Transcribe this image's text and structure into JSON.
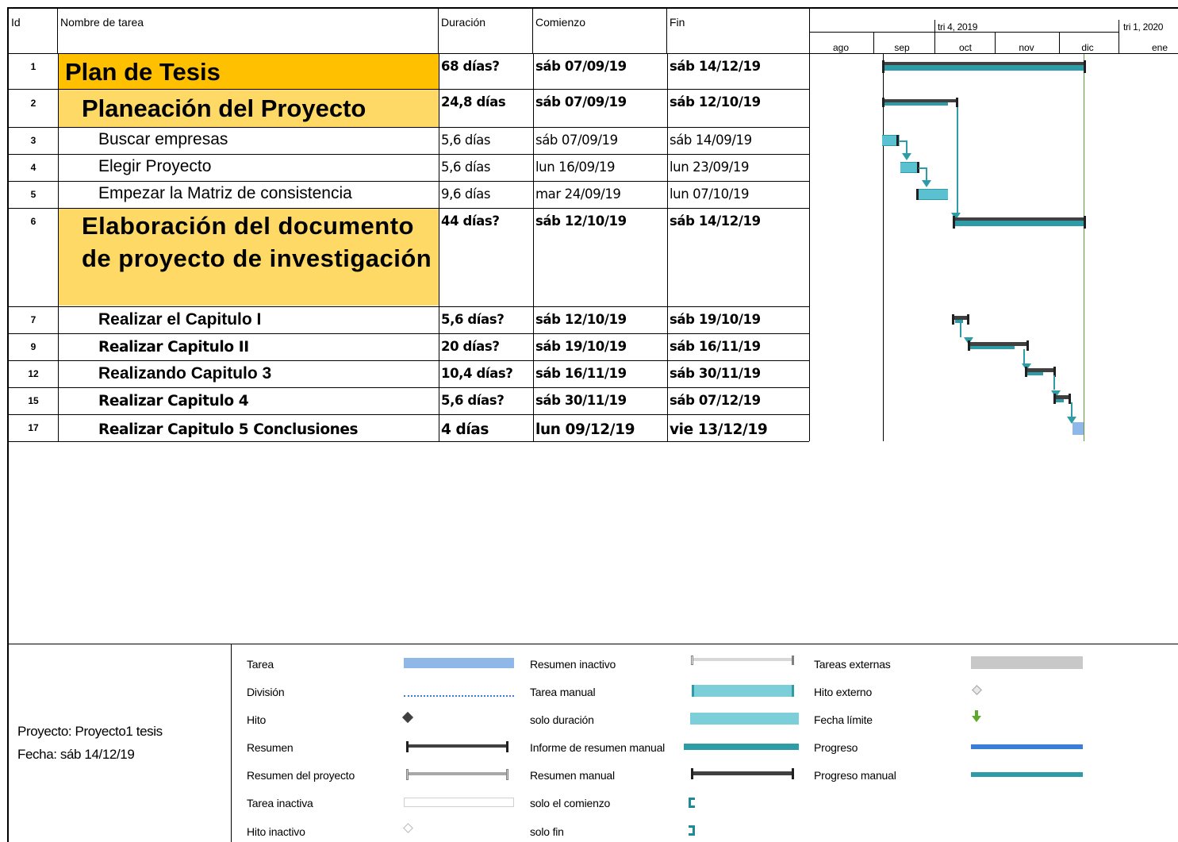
{
  "header": {
    "id": "Id",
    "name": "Nombre de tarea",
    "duration": "Duración",
    "start": "Comienzo",
    "finish": "Fin"
  },
  "timescale": {
    "quarters": [
      "tri 4, 2019",
      "tri 1, 2020"
    ],
    "months": [
      "ago",
      "sep",
      "oct",
      "nov",
      "dic",
      "ene"
    ]
  },
  "tasks": [
    {
      "id": "1",
      "name": "Plan de Tesis",
      "duration": "68 días?",
      "start": "sáb 07/09/19",
      "finish": "sáb 14/12/19"
    },
    {
      "id": "2",
      "name": "Planeación del Proyecto",
      "duration": "24,8 días",
      "start": "sáb 07/09/19",
      "finish": "sáb 12/10/19"
    },
    {
      "id": "3",
      "name": "Buscar empresas",
      "duration": "5,6 días",
      "start": "sáb 07/09/19",
      "finish": "sáb 14/09/19"
    },
    {
      "id": "4",
      "name": "Elegir Proyecto",
      "duration": "5,6 días",
      "start": "lun 16/09/19",
      "finish": "lun 23/09/19"
    },
    {
      "id": "5",
      "name": "Empezar la Matriz de consistencia",
      "duration": "9,6 días",
      "start": "mar 24/09/19",
      "finish": "lun 07/10/19"
    },
    {
      "id": "6",
      "name_line1": "Elaboración del documento",
      "name_line2": "de proyecto de investigación",
      "duration": "44 días?",
      "start": "sáb 12/10/19",
      "finish": "sáb 14/12/19"
    },
    {
      "id": "7",
      "name": "Realizar el Capitulo I",
      "duration": "5,6 días?",
      "start": "sáb 12/10/19",
      "finish": "sáb 19/10/19"
    },
    {
      "id": "9",
      "name": "Realizar Capitulo II",
      "duration": "20 días?",
      "start": "sáb 19/10/19",
      "finish": "sáb 16/11/19"
    },
    {
      "id": "12",
      "name": "Realizando Capitulo 3",
      "duration": "10,4 días?",
      "start": "sáb 16/11/19",
      "finish": "sáb 30/11/19"
    },
    {
      "id": "15",
      "name": "Realizar Capitulo 4",
      "duration": "5,6 días?",
      "start": "sáb 30/11/19",
      "finish": "sáb 07/12/19"
    },
    {
      "id": "17",
      "name": "Realizar Capitulo 5 Conclusiones",
      "duration": "4 días",
      "start": "lun 09/12/19",
      "finish": "vie 13/12/19"
    }
  ],
  "project_info": {
    "project": "Proyecto: Proyecto1 tesis",
    "date": "Fecha: sáb 14/12/19"
  },
  "legend": {
    "col1": [
      "Tarea",
      "División",
      "Hito",
      "Resumen",
      "Resumen del proyecto",
      "Tarea inactiva",
      "Hito inactivo"
    ],
    "col2": [
      "Resumen inactivo",
      "Tarea manual",
      "solo duración",
      "Informe de resumen manual",
      "Resumen manual",
      "solo el comienzo",
      "solo fin"
    ],
    "col3": [
      "Tareas externas",
      "Hito externo",
      "Fecha límite",
      "Progreso",
      "Progreso manual"
    ]
  },
  "colors": {
    "highlight_level1": "#FFC000",
    "highlight_level2": "#FFD966",
    "task_bar": "#5BC0CF",
    "summary_bar": "#404040",
    "link": "#2E9CA6",
    "progress": "#3A7FD5"
  }
}
